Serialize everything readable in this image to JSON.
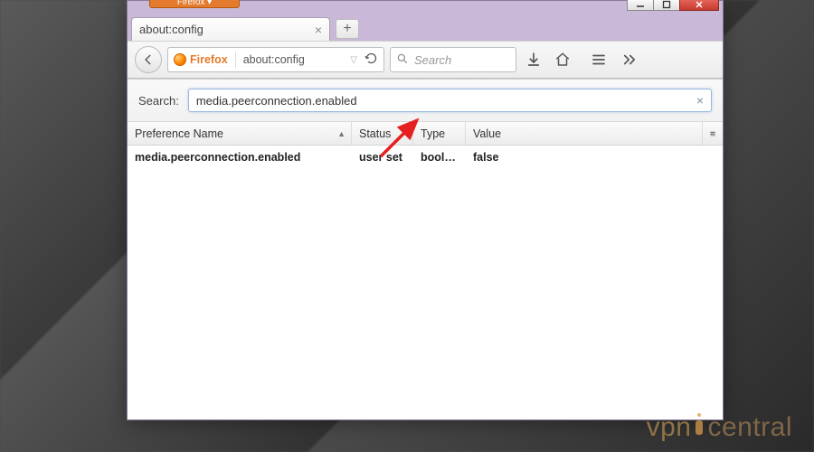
{
  "window": {
    "browser_badge": "Firefox ▾"
  },
  "tabs": {
    "active_title": "about:config"
  },
  "navbar": {
    "identity": "Firefox",
    "url": "about:config",
    "search_placeholder": "Search"
  },
  "config": {
    "search_label": "Search:",
    "search_value": "media.peerconnection.enabled",
    "columns": {
      "name": "Preference Name",
      "status": "Status",
      "type": "Type",
      "value": "Value"
    },
    "rows": [
      {
        "name": "media.peerconnection.enabled",
        "status": "user set",
        "type": "boole…",
        "value": "false"
      }
    ]
  },
  "watermark": {
    "a": "vpn",
    "b": "central"
  }
}
